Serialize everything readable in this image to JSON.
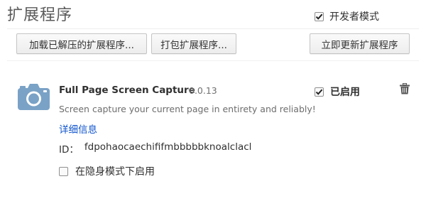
{
  "header": {
    "title": "扩展程序",
    "developer_mode": {
      "label": "开发者模式",
      "checked": true
    }
  },
  "toolbar": {
    "load_unpacked_label": "加载已解压的扩展程序...",
    "pack_label": "打包扩展程序...",
    "update_now_label": "立即更新扩展程序"
  },
  "extension": {
    "icon": "camera-icon",
    "name": "Full Page Screen Capture",
    "version": "0.0.13",
    "enabled_label": "已启用",
    "enabled": true,
    "description": "Screen capture your current page in entirety and reliably!",
    "details_link": "详细信息",
    "id_label": "ID：",
    "id_value": "fdpohaocaechififmbbbbbknoalclacl",
    "incognito_label": "在隐身模式下启用",
    "incognito_enabled": false,
    "remove_icon": "trash-icon"
  },
  "colors": {
    "link": "#1155cc",
    "icon_blue": "#7aa2c6"
  }
}
